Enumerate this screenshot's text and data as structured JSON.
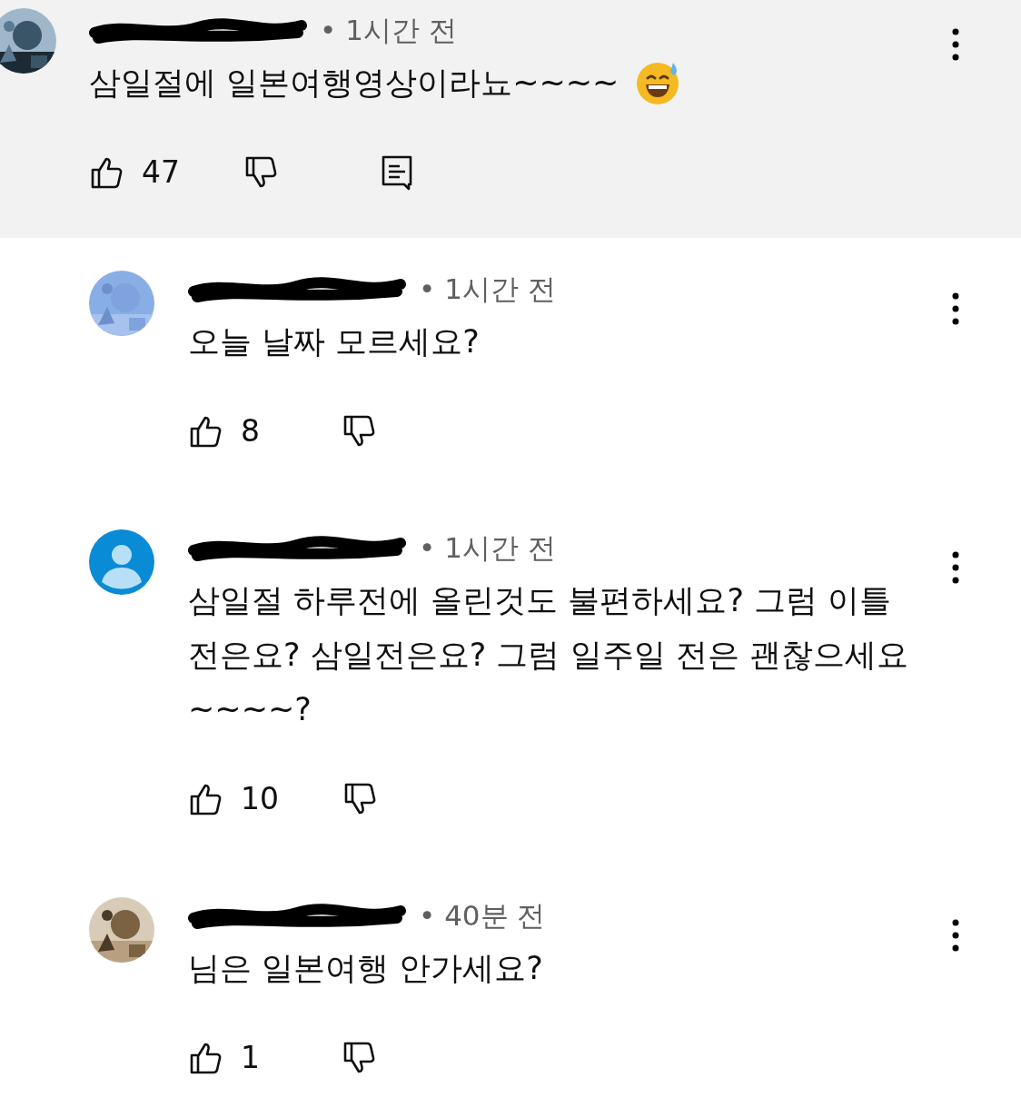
{
  "comments": [
    {
      "highlighted": true,
      "time": "• 1시간 전",
      "text": "삼일절에 일본여행영상이라뇨~~~~",
      "emoji": true,
      "likes": "47",
      "reply_button": true
    },
    {
      "highlighted": false,
      "time": "• 1시간 전",
      "text": "오늘 날짜 모르세요?",
      "emoji": false,
      "likes": "8",
      "reply_button": false
    },
    {
      "highlighted": false,
      "avatar": {
        "kind": "default"
      },
      "time": "• 1시간 전",
      "text": "삼일절 하루전에 올린것도 불편하세요? 그럼 이틀 전은요? 삼일전은요? 그럼 일주일 전은 괜찮으세요 ~~~~?",
      "emoji": false,
      "likes": "10",
      "reply_button": false
    },
    {
      "highlighted": false,
      "time": "• 40분 전",
      "text": "님은 일본여행 안가세요?",
      "emoji": false,
      "likes": "1",
      "reply_button": false
    }
  ]
}
